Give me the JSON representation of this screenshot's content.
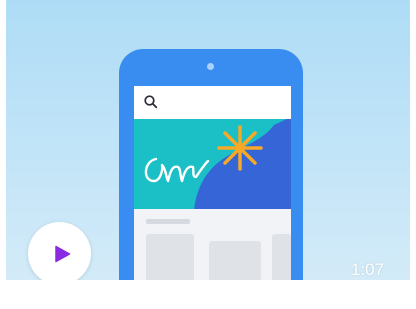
{
  "video_card": {
    "duration": "1:07",
    "colors": {
      "background": "#aedcf6",
      "phone_body": "#3a8df0",
      "banner_teal": "#1ac0c6",
      "banner_blue": "#3565d6",
      "sparkle": "#f7a825",
      "play_triangle": "#8a2be2"
    },
    "icons": {
      "search": "search-icon",
      "play": "play-icon",
      "sparkle": "sparkle-icon",
      "signature": "handwriting-signature"
    }
  }
}
